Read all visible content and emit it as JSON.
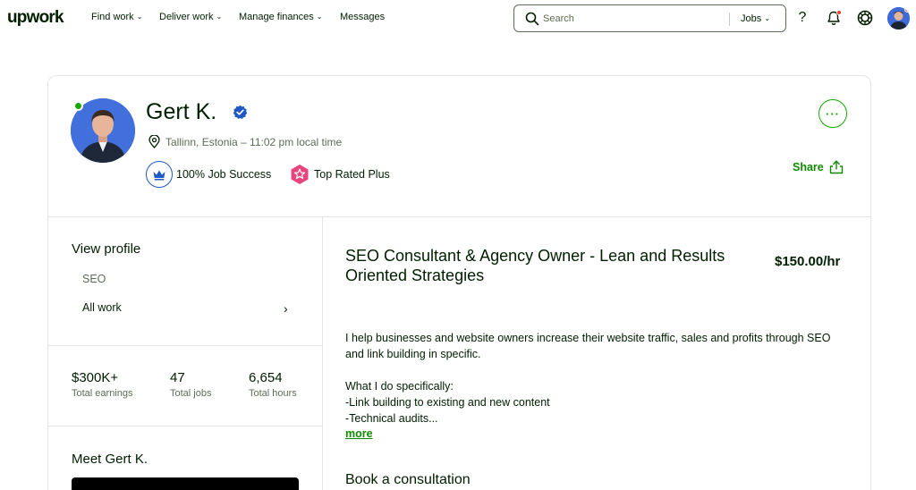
{
  "nav": {
    "logo": "upwork",
    "items": [
      {
        "label": "Find work",
        "dropdown": true
      },
      {
        "label": "Deliver work",
        "dropdown": true
      },
      {
        "label": "Manage finances",
        "dropdown": true
      },
      {
        "label": "Messages",
        "dropdown": false
      }
    ],
    "search_placeholder": "Search",
    "search_scope": "Jobs",
    "help_glyph": "?",
    "icons": [
      "search-icon",
      "help-icon",
      "bell-icon",
      "hub-icon"
    ]
  },
  "profile": {
    "name": "Gert K.",
    "location": "Tallinn, Estonia – 11:02 pm local time",
    "badges": {
      "job_success": "100% Job Success",
      "top_rated": "Top Rated Plus"
    },
    "more_label": "···",
    "share_label": "Share",
    "online": true,
    "verified": true
  },
  "sidebar": {
    "view_profile": "View profile",
    "items": [
      "SEO",
      "All work"
    ],
    "stats": [
      {
        "value": "$300K+",
        "label": "Total earnings"
      },
      {
        "value": "47",
        "label": "Total jobs"
      },
      {
        "value": "6,654",
        "label": "Total hours"
      }
    ],
    "meet_title": "Meet Gert K."
  },
  "main": {
    "headline": "SEO Consultant & Agency Owner - Lean and Results Oriented Strategies",
    "rate": "$150.00/hr",
    "description": [
      "I help businesses and website owners increase their website traffic, sales and profits through SEO and link building in specific.",
      "",
      "What I do specifically:",
      "-Link building to existing and new content",
      "-Technical audits..."
    ],
    "more_label": "more",
    "consultation_title": "Book a consultation"
  },
  "colors": {
    "brand_green": "#14a800",
    "link_green": "#108a00",
    "verified_blue": "#1f57c3",
    "top_rated_pink": "#e8457c",
    "notification_red": "#e6432c"
  }
}
